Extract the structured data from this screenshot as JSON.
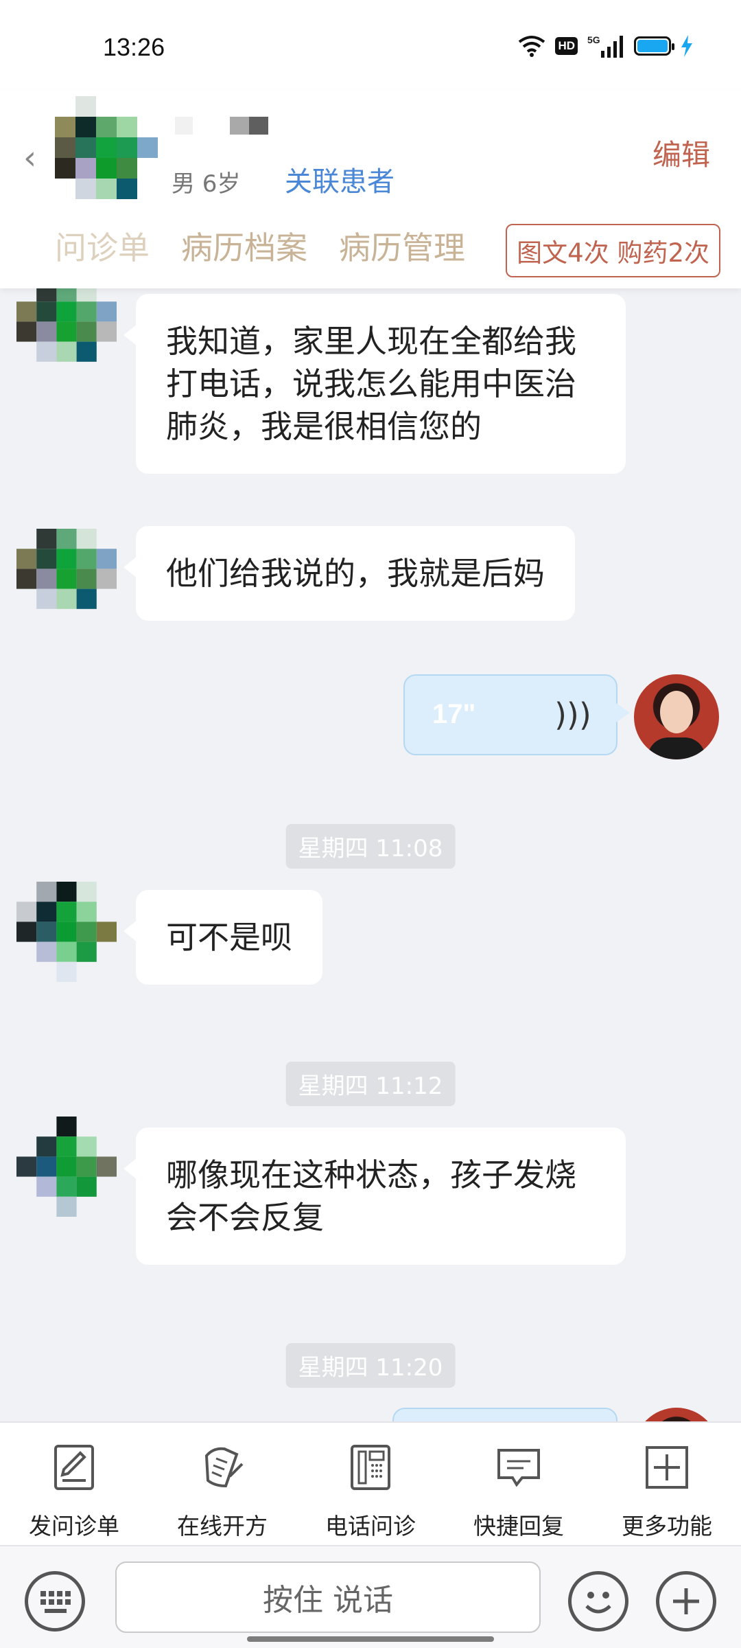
{
  "status_bar": {
    "time": "13:26",
    "network": "5G",
    "hd": "HD"
  },
  "header": {
    "patient_info": "男 6岁",
    "link_label": "关联患者",
    "edit_label": "编辑",
    "tabs": [
      "问诊单",
      "病历档案",
      "病历管理"
    ],
    "count_badge": "图文4次 购药2次"
  },
  "messages": {
    "m1": "我知道，家里人现在全都给我打电话，说我怎么能用中医治肺炎，我是很相信您的",
    "m2": "他们给我说的，我就是后妈",
    "voice_duration": "17\"",
    "t1": "星期四 11:08",
    "m3": "可不是呗",
    "t2": "星期四 11:12",
    "m4": "哪像现在这种状态，孩子发烧会不会反复",
    "t3": "星期四 11:20"
  },
  "toolbar": {
    "items": [
      "发问诊单",
      "在线开方",
      "电话问诊",
      "快捷回复",
      "更多功能"
    ]
  },
  "input_bar": {
    "hold_to_talk": "按住 说话"
  }
}
